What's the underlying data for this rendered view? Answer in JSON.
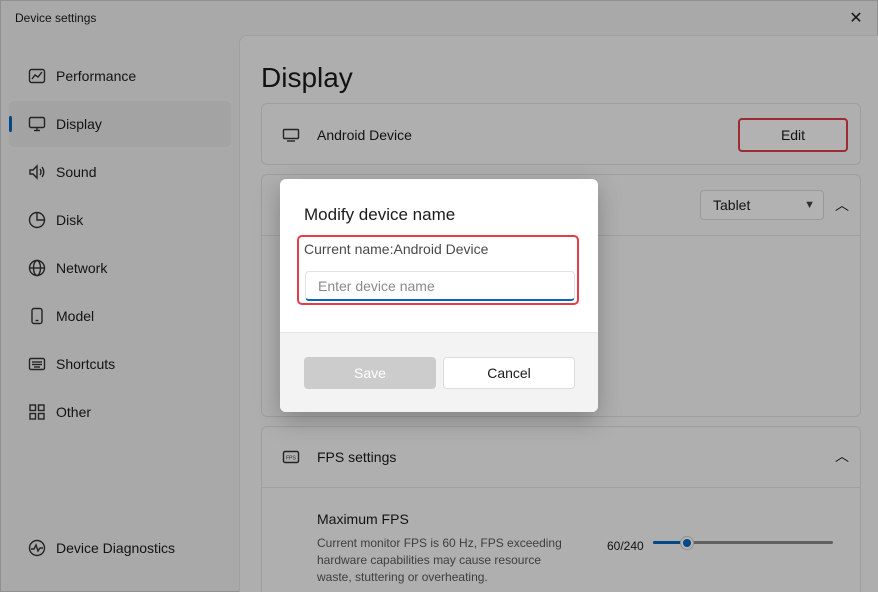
{
  "window": {
    "title": "Device settings",
    "close_icon": "close-icon"
  },
  "sidebar": {
    "items": [
      {
        "label": "Performance",
        "icon": "performance-chart-icon",
        "active": false
      },
      {
        "label": "Display",
        "icon": "monitor-icon",
        "active": true
      },
      {
        "label": "Sound",
        "icon": "speaker-icon",
        "active": false
      },
      {
        "label": "Disk",
        "icon": "pie-chart-icon",
        "active": false
      },
      {
        "label": "Network",
        "icon": "globe-icon",
        "active": false
      },
      {
        "label": "Model",
        "icon": "phone-icon",
        "active": false
      },
      {
        "label": "Shortcuts",
        "icon": "keyboard-icon",
        "active": false
      },
      {
        "label": "Other",
        "icon": "grid-icon",
        "active": false
      }
    ],
    "diagnostics": {
      "label": "Device Diagnostics",
      "icon": "diagnostics-icon"
    }
  },
  "main": {
    "page_title": "Display",
    "device_card": {
      "label": "Android Device",
      "icon": "display-device-icon",
      "button": "Edit"
    },
    "mode_card": {
      "selected": "Tablet",
      "chevron": "chevron-up-icon"
    },
    "fps_card": {
      "title": "FPS settings",
      "icon": "fps-icon",
      "max_fps_label": "Maximum FPS",
      "description": "Current monitor FPS is 60 Hz, FPS exceeding hardware capabilities may cause resource waste, stuttering or overheating.",
      "value_text": "60/240",
      "slider_value": 60,
      "slider_max": 240
    }
  },
  "dialog": {
    "title": "Modify device name",
    "current_name": "Current name:Android Device",
    "input_placeholder": "Enter device name",
    "input_value": "",
    "save_label": "Save",
    "cancel_label": "Cancel"
  },
  "colors": {
    "accent": "#0067c0",
    "highlight": "#e23d4b"
  }
}
